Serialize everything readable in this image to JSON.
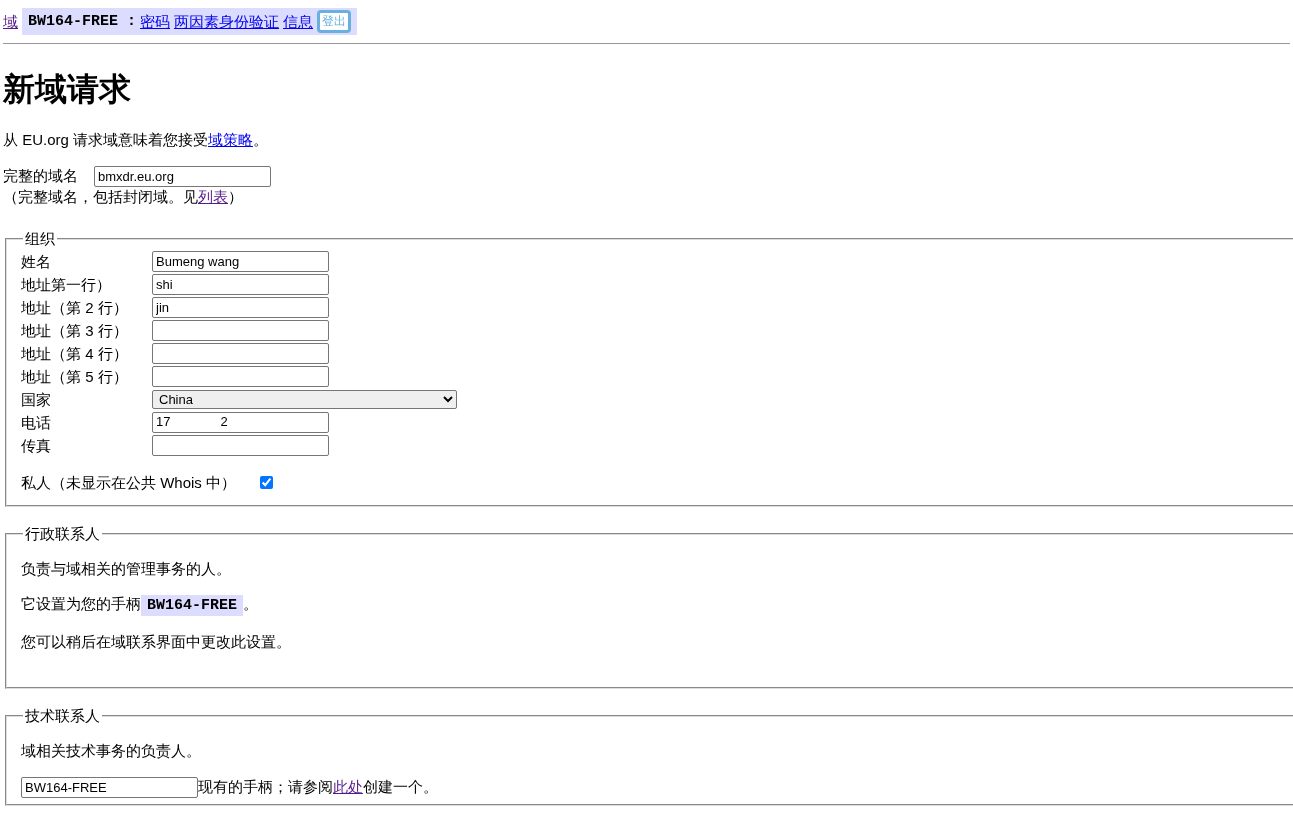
{
  "topbar": {
    "domain_link": "域",
    "handle": "BW164-FREE",
    "separator": ":",
    "links": [
      {
        "label": "密码"
      },
      {
        "label": "两因素身份验证"
      },
      {
        "label": "信息"
      }
    ],
    "logout": "登出"
  },
  "heading": "新域请求",
  "intro": {
    "text": "从 EU.org 请求域意味着您接受",
    "link": "域策略",
    "end": "。"
  },
  "fqdn": {
    "label": "完整的域名",
    "value": "bmxdr.eu.org",
    "hint": "（完整域名，包括封闭域。见",
    "hint_link": "列表",
    "hint_end": "）"
  },
  "organization": {
    "legend": "组织",
    "fields": [
      {
        "kind": "text",
        "label": "姓名",
        "value": "Bumeng wang"
      },
      {
        "kind": "text",
        "label": "地址第一行）",
        "value": "shi"
      },
      {
        "kind": "text",
        "label": "地址（第 2 行）",
        "value": "jin"
      },
      {
        "kind": "text",
        "label": "地址（第 3 行）"
      },
      {
        "kind": "text",
        "label": "地址（第 4 行）"
      },
      {
        "kind": "text",
        "label": "地址（第 5 行）"
      },
      {
        "kind": "select",
        "label": "国家",
        "value": "China"
      },
      {
        "kind": "text",
        "label": "电话",
        "value": "17",
        "value_end": "2"
      },
      {
        "kind": "text",
        "label": "传真"
      }
    ],
    "private": {
      "label": "私人（未显示在公共 Whois 中）",
      "checked": true
    }
  },
  "admin_contact": {
    "legend": "行政联系人",
    "lines": [
      "负责与域相关的管理事务的人。"
    ],
    "handle_text": "它设置为您的手柄",
    "handle": "BW164-FREE",
    "handle_end": "。",
    "note": "您可以稍后在域联系界面中更改此设置。"
  },
  "tech_contact": {
    "legend": "技术联系人",
    "text": "域相关技术事务的负责人。",
    "handle_value": "BW164-FREE",
    "after": "现有的手柄；请参阅",
    "link": "此处",
    "end": "创建一个。"
  }
}
